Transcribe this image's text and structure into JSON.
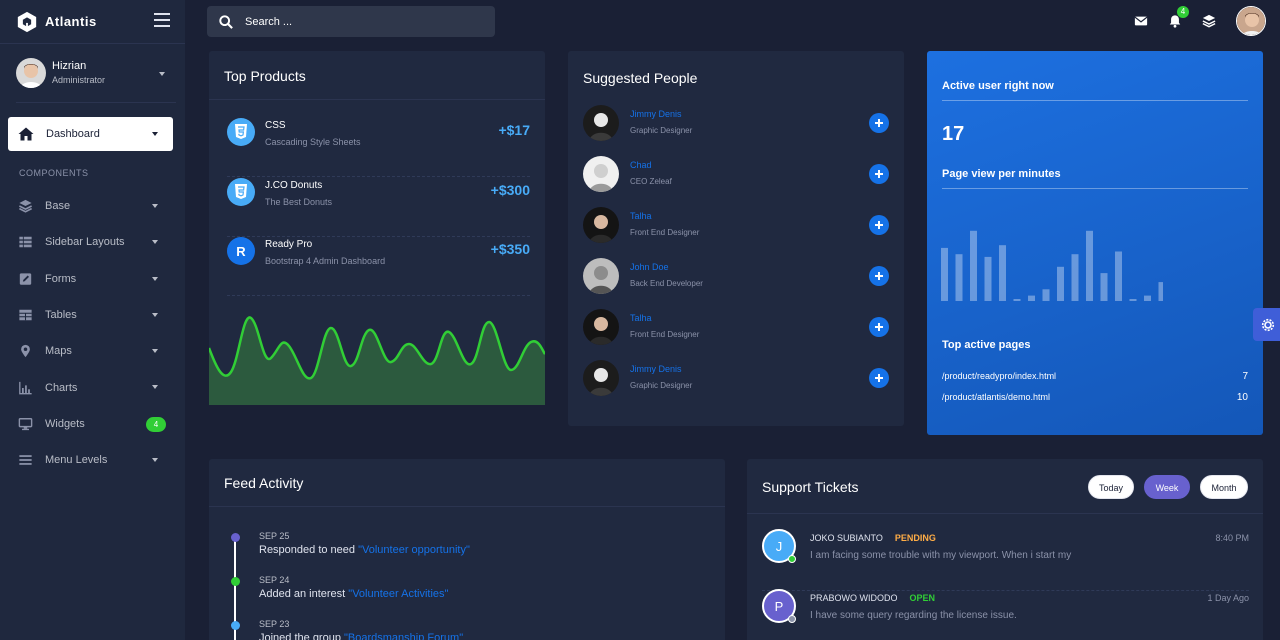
{
  "brand": {
    "name": "Atlantis"
  },
  "search": {
    "placeholder": "Search ..."
  },
  "notifications": {
    "count": "4"
  },
  "user": {
    "name": "Hizrian",
    "role": "Administrator"
  },
  "sidebar": {
    "dashboard_label": "Dashboard",
    "section_title": "COMPONENTS",
    "items": [
      {
        "label": "Base",
        "icon": "layers-icon"
      },
      {
        "label": "Sidebar Layouts",
        "icon": "th-list-icon"
      },
      {
        "label": "Forms",
        "icon": "pen-square-icon"
      },
      {
        "label": "Tables",
        "icon": "table-icon"
      },
      {
        "label": "Maps",
        "icon": "map-marker-icon"
      },
      {
        "label": "Charts",
        "icon": "bar-chart-icon"
      },
      {
        "label": "Widgets",
        "icon": "desktop-icon",
        "badge": "4"
      },
      {
        "label": "Menu Levels",
        "icon": "bars-icon"
      }
    ]
  },
  "top_products": {
    "title": "Top Products",
    "items": [
      {
        "name": "CSS",
        "desc": "Cascading Style Sheets",
        "price": "+$17",
        "icon": "css3-icon"
      },
      {
        "name": "J.CO Donuts",
        "desc": "The Best Donuts",
        "price": "+$300",
        "icon": "css3-icon"
      },
      {
        "name": "Ready Pro",
        "desc": "Bootstrap 4 Admin Dashboard",
        "price": "+$350",
        "icon": "R"
      }
    ]
  },
  "suggested_people": {
    "title": "Suggested People",
    "people": [
      {
        "name": "Jimmy Denis",
        "role": "Graphic Designer"
      },
      {
        "name": "Chad",
        "role": "CEO Zeleaf"
      },
      {
        "name": "Talha",
        "role": "Front End Designer"
      },
      {
        "name": "John Doe",
        "role": "Back End Developer"
      },
      {
        "name": "Talha",
        "role": "Front End Designer"
      },
      {
        "name": "Jimmy Denis",
        "role": "Graphic Designer"
      }
    ]
  },
  "active_users": {
    "title": "Active user right now",
    "count": "17",
    "page_view_label": "Page view per minutes",
    "page_view_bars": [
      0.59,
      0.52,
      0.78,
      0.49,
      0.62,
      0.02,
      0.06,
      0.13,
      0.38,
      0.52,
      0.78,
      0.31,
      0.55,
      0.02,
      0.06,
      0.21
    ],
    "top_pages_label": "Top active pages",
    "pages": [
      {
        "path": "/product/readypro/index.html",
        "count": "7"
      },
      {
        "path": "/product/atlantis/demo.html",
        "count": "10"
      }
    ]
  },
  "feed": {
    "title": "Feed Activity",
    "items": [
      {
        "date": "SEP 25",
        "text": "Responded to need ",
        "link": "\"Volunteer opportunity\"",
        "color": "#6861ce"
      },
      {
        "date": "SEP 24",
        "text": "Added an interest ",
        "link": "\"Volunteer Activities\"",
        "color": "#31ce36"
      },
      {
        "date": "SEP 23",
        "text": "Joined the group ",
        "link": "\"Boardsmanship Forum\"",
        "color": "#48abf7"
      }
    ]
  },
  "support": {
    "title": "Support Tickets",
    "filters": [
      "Today",
      "Week",
      "Month"
    ],
    "active_filter": "Week",
    "tickets": [
      {
        "initial": "J",
        "name": "JOKO SUBIANTO",
        "status": "PENDING",
        "status_color": "#ffad46",
        "message": "I am facing some trouble with my viewport. When i start my",
        "time": "8:40 PM",
        "avatar_color": "#48abf7",
        "dot_color": "#31ce36"
      },
      {
        "initial": "P",
        "name": "PRABOWO WIDODO",
        "status": "OPEN",
        "status_color": "#31ce36",
        "message": "I have some query regarding the license issue.",
        "time": "1 Day Ago",
        "avatar_color": "#6861ce",
        "dot_color": "#8b92a9"
      }
    ]
  },
  "colors": {
    "bg": "#1a2035",
    "card": "#202940",
    "primary": "#1572e8",
    "success": "#31ce36",
    "info": "#48abf7",
    "accent_purple": "#6861ce"
  }
}
